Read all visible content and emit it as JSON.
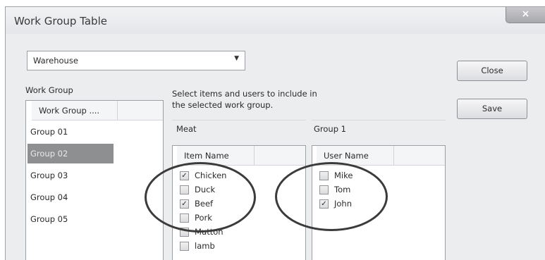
{
  "window": {
    "title": "Work Group Table",
    "close_glyph": "×"
  },
  "category_select": {
    "value": "Warehouse",
    "arrow": "▼"
  },
  "work_group": {
    "label": "Work Group",
    "column_header": "Work Group ....",
    "items": [
      {
        "label": "Group 01",
        "selected": false
      },
      {
        "label": "Group 02",
        "selected": true
      },
      {
        "label": "Group 03",
        "selected": false
      },
      {
        "label": "Group 04",
        "selected": false
      },
      {
        "label": "Group 05",
        "selected": false
      }
    ]
  },
  "instructions": {
    "line1": "Select items and users to include in",
    "line2": "the selected work group."
  },
  "items_section": {
    "title": "Meat",
    "column_header": "Item Name",
    "items": [
      {
        "label": "Chicken",
        "checked": true
      },
      {
        "label": "Duck",
        "checked": false
      },
      {
        "label": "Beef",
        "checked": true
      },
      {
        "label": "Pork",
        "checked": false
      },
      {
        "label": "Mutton",
        "checked": false
      },
      {
        "label": "lamb",
        "checked": false
      }
    ]
  },
  "users_section": {
    "title": "Group 1",
    "column_header": "User Name",
    "users": [
      {
        "label": "Mike",
        "checked": false
      },
      {
        "label": "Tom",
        "checked": false
      },
      {
        "label": "John",
        "checked": true
      }
    ]
  },
  "buttons": {
    "close": "Close",
    "save": "Save"
  },
  "icons": {
    "checkmark": "✓",
    "close": "close-icon",
    "dropdown": "chevron-down-icon"
  }
}
